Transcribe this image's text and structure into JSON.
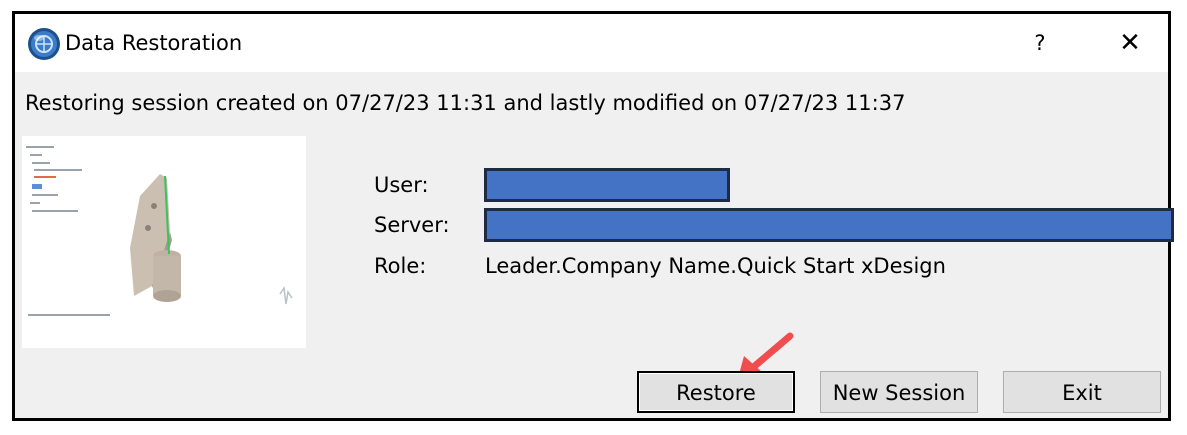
{
  "window": {
    "title": "Data Restoration",
    "help_label": "?",
    "close_label": "✕",
    "icon": "app-logo-icon"
  },
  "message": "Restoring session created on 07/27/23 11:31 and lastly modified on 07/27/23 11:37",
  "fields": {
    "user_label": "User:",
    "server_label": "Server:",
    "role_label": "Role:",
    "role_value": "Leader.Company Name.Quick Start xDesign"
  },
  "buttons": {
    "restore": "Restore",
    "new_session": "New Session",
    "exit": "Exit"
  },
  "colors": {
    "redaction": "#4472c4",
    "annotation_arrow": "#f04e4e"
  }
}
